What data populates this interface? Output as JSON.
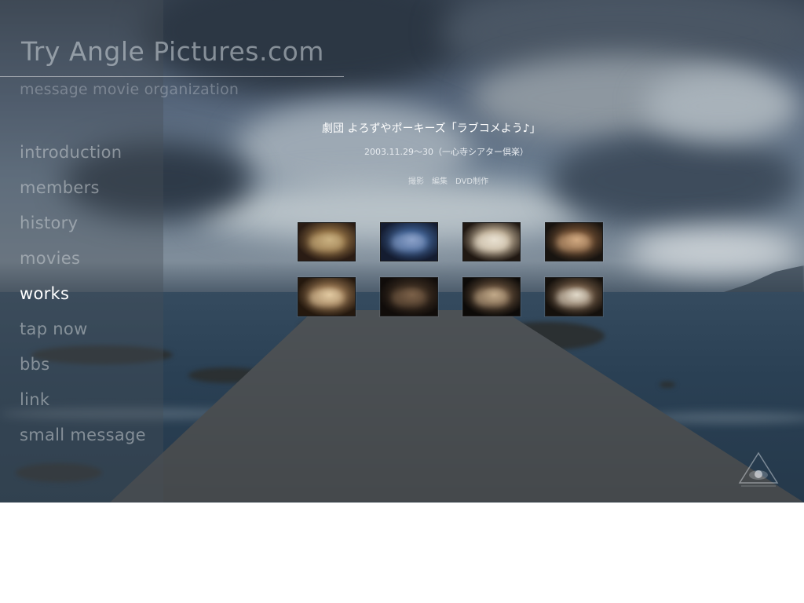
{
  "site": {
    "title": "Try Angle Pictures.com",
    "tagline": "message movie organization"
  },
  "nav": {
    "items": [
      {
        "label": "introduction",
        "active": false
      },
      {
        "label": "members",
        "active": false
      },
      {
        "label": "history",
        "active": false
      },
      {
        "label": "movies",
        "active": false
      },
      {
        "label": "works",
        "active": true
      },
      {
        "label": "tap now",
        "active": false
      },
      {
        "label": "bbs",
        "active": false
      },
      {
        "label": "link",
        "active": false
      },
      {
        "label": "small message",
        "active": false
      }
    ]
  },
  "work": {
    "title": "劇団 よろずやポーキーズ「ラブコメよう♪」",
    "date": "2003.11.29～30（一心寺シアター倶楽）",
    "credits": "撮影　編集　DVD制作"
  },
  "thumbnails": [
    {
      "id": "thumb-1",
      "scene": "stage-band",
      "colors": [
        "#2a1c14",
        "#8a6a40",
        "#c9b080"
      ]
    },
    {
      "id": "thumb-2",
      "scene": "blue-stage",
      "colors": [
        "#141c30",
        "#3a5a8a",
        "#8aa0c8"
      ]
    },
    {
      "id": "thumb-3",
      "scene": "performers-white",
      "colors": [
        "#201812",
        "#b8a890",
        "#e8e0d0"
      ]
    },
    {
      "id": "thumb-4",
      "scene": "singer-arms-up",
      "colors": [
        "#181410",
        "#6a4a30",
        "#d0a880"
      ]
    },
    {
      "id": "thumb-5",
      "scene": "dancers",
      "colors": [
        "#24180e",
        "#8a6a48",
        "#e0c8a0"
      ]
    },
    {
      "id": "thumb-6",
      "scene": "dark-stage",
      "colors": [
        "#100c0a",
        "#3a2c20",
        "#7a6048"
      ]
    },
    {
      "id": "thumb-7",
      "scene": "spotlight",
      "colors": [
        "#0c0a08",
        "#5a4634",
        "#c0a888"
      ]
    },
    {
      "id": "thumb-8",
      "scene": "table-group",
      "colors": [
        "#14100c",
        "#6a5440",
        "#e0d8c8"
      ]
    }
  ],
  "colors": {
    "active_nav": "#ffffff",
    "inactive_nav": "#c8cdd2",
    "sidebar_overlay": "#464e56"
  }
}
